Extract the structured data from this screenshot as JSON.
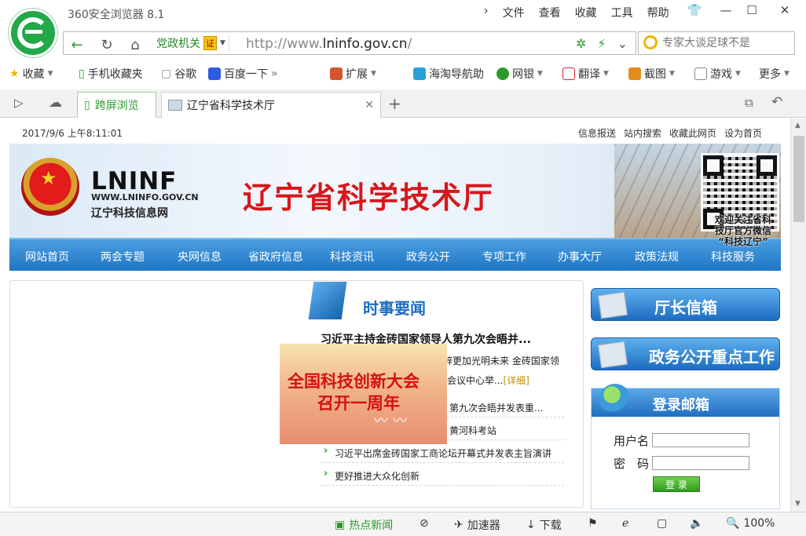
{
  "browser": {
    "app_title": "360安全浏览器 8.1",
    "menu": [
      "文件",
      "查看",
      "收藏",
      "工具",
      "帮助"
    ],
    "address": {
      "gov_label": "党政机关",
      "gov_badge": "证",
      "url_prefix": "http://www.",
      "url_domain": "lninfo.gov.cn",
      "url_suffix": "/",
      "search_placeholder": "专家大谈足球不是"
    },
    "bookmarks": [
      "收藏",
      "手机收藏夹",
      "谷歌",
      "百度一下",
      "扩展",
      "海淘导航助",
      "网银",
      "翻译",
      "截图",
      "游戏",
      "更多"
    ],
    "tabs": {
      "split_label": "跨屏浏览",
      "active_label": "辽宁省科学技术厅"
    },
    "status": {
      "hot_news": "热点新闻",
      "speedup": "加速器",
      "download": "下载",
      "zoom": "100%"
    },
    "colors": {
      "accent_green": "#23a84a",
      "nav_blue": "#1f75c4",
      "title_red": "#d6171b"
    }
  },
  "page": {
    "datetime": "2017/9/6 上午8:11:01",
    "top_links": [
      "信息报送",
      "站内搜索",
      "收藏此网页",
      "设为首页"
    ],
    "banner": {
      "logo_text": "LNINF",
      "logo_url": "WWW.LNINFO.GOV.CN",
      "logo_cn": "辽宁科技信息网",
      "site_title": "辽宁省科学技术厅",
      "qr_caption_1": "欢迎关注省科",
      "qr_caption_2": "技厅官方微信",
      "qr_caption_3": "“科技辽宁”"
    },
    "nav": [
      "网站首页",
      "两会专题",
      "央网信息",
      "省政府信息",
      "科技资讯",
      "政务公开",
      "专项工作",
      "办事大厅",
      "政策法规",
      "科技服务"
    ],
    "news": {
      "header": "时事要闻",
      "lead": "习近平主持金砖国家领导人第九次会晤并...",
      "lead_sub_1": "辞更加光明未来 金砖国家领",
      "lead_sub_2": "会议中心举...",
      "more": "[详细]",
      "items": [
        "第九次会晤并发表重...",
        "黄河科考站",
        "习近平出席金砖国家工商论坛开幕式并发表主旨演讲",
        "更好推进大众化创新"
      ]
    },
    "promo": {
      "line1": "全国科技创新大会",
      "line2": "召开一周年"
    },
    "sidebar": {
      "director_mail": "厅长信箱",
      "gov_open": "政务公开重点工作",
      "login_title": "登录邮箱",
      "username_label": "用户名",
      "password_label": "密　码",
      "login_button": "登 录"
    }
  }
}
